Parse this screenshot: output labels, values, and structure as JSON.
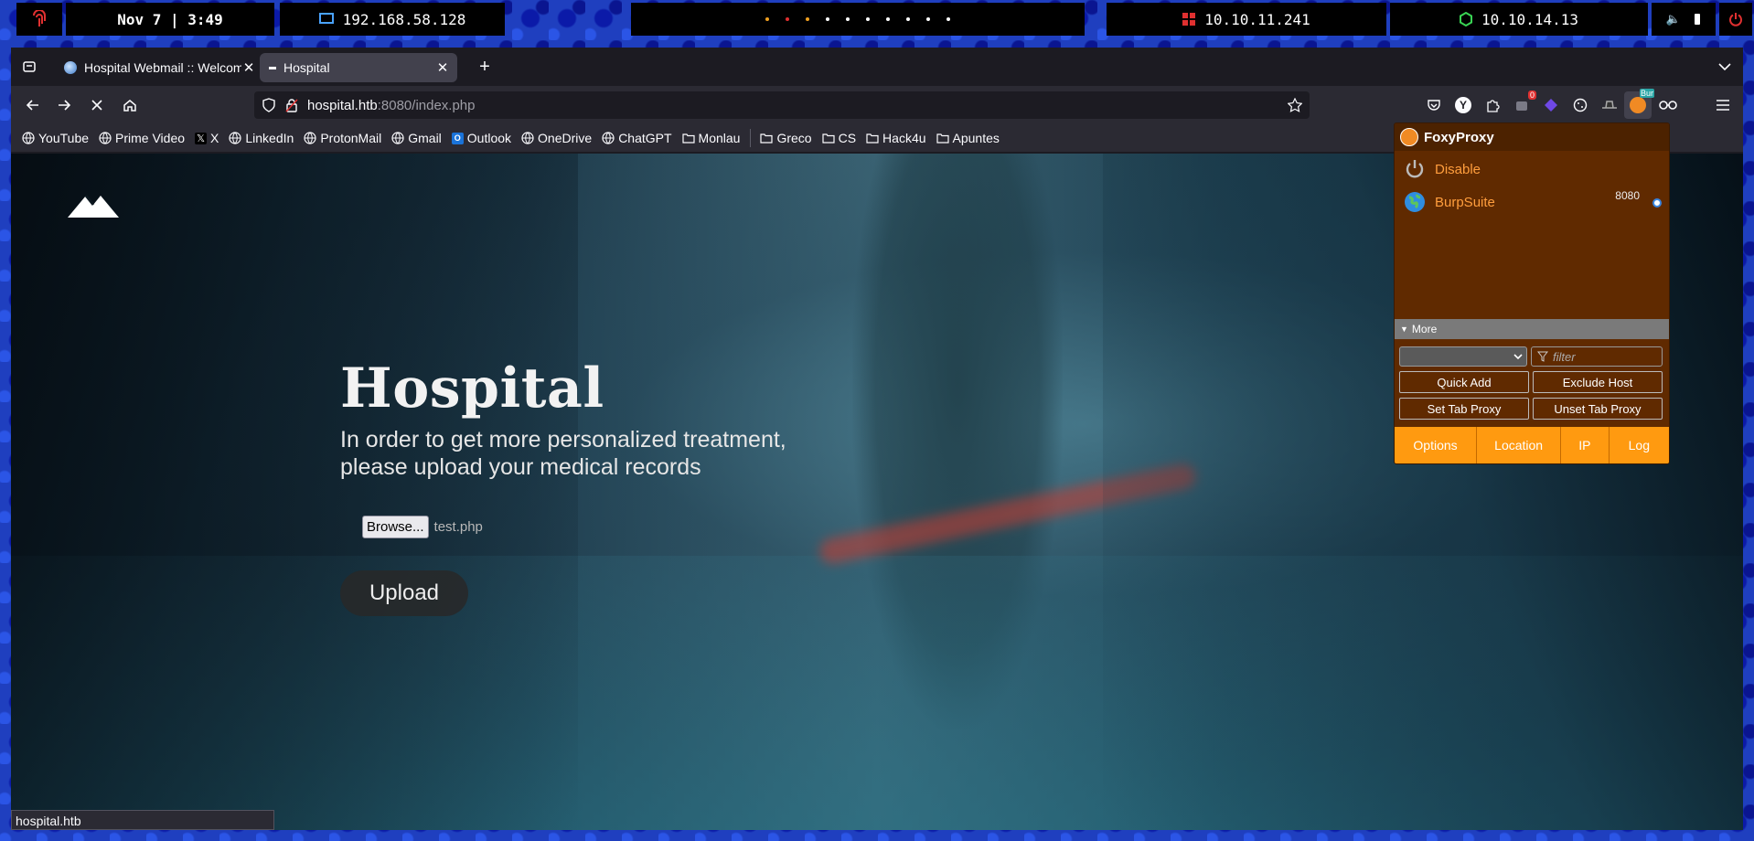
{
  "system_panel": {
    "datetime": "Nov 7 | 3:49",
    "local_ip": "192.168.58.128",
    "target_ip": "10.10.11.241",
    "vpn_ip": "10.10.14.13"
  },
  "tabs": [
    {
      "title": "Hospital Webmail :: Welcome",
      "active": false
    },
    {
      "title": "Hospital",
      "active": true
    }
  ],
  "urlbar": {
    "host": "hospital.htb",
    "rest": ":8080/index.php"
  },
  "bookmarks": [
    {
      "label": "YouTube",
      "icon": "globe-icon"
    },
    {
      "label": "Prime Video",
      "icon": "globe-icon"
    },
    {
      "label": "X",
      "icon": "x-logo-icon"
    },
    {
      "label": "LinkedIn",
      "icon": "globe-icon"
    },
    {
      "label": "ProtonMail",
      "icon": "globe-icon"
    },
    {
      "label": "Gmail",
      "icon": "globe-icon"
    },
    {
      "label": "Outlook",
      "icon": "outlook-icon"
    },
    {
      "label": "OneDrive",
      "icon": "globe-icon"
    },
    {
      "label": "ChatGPT",
      "icon": "globe-icon"
    },
    {
      "label": "Monlau",
      "icon": "folder-icon"
    },
    {
      "label": "Greco",
      "icon": "folder-icon"
    },
    {
      "label": "CS",
      "icon": "folder-icon"
    },
    {
      "label": "Hack4u",
      "icon": "folder-icon"
    },
    {
      "label": "Apuntes",
      "icon": "folder-icon"
    }
  ],
  "toolbar": {
    "extension_badge": "0",
    "burp_badge": "Bur"
  },
  "page": {
    "title": "Hospital",
    "subtitle": "In order to get more personalized treatment, please upload your medical records",
    "browse_label": "Browse...",
    "file_name": "test.php",
    "upload_label": "Upload"
  },
  "statusbar": {
    "text": "hospital.htb"
  },
  "foxyproxy": {
    "title": "FoxyProxy",
    "disable_label": "Disable",
    "proxy_name": "BurpSuite",
    "proxy_port": "8080",
    "more_label": "More",
    "filter_placeholder": "filter",
    "quick_add": "Quick Add",
    "exclude_host": "Exclude Host",
    "set_tab_proxy": "Set Tab Proxy",
    "unset_tab_proxy": "Unset Tab Proxy",
    "footer": [
      "Options",
      "Location",
      "IP",
      "Log"
    ]
  },
  "colors": {
    "accent_orange": "#ff9a10",
    "foxy_bg": "#602a00",
    "browser_bg": "#1c1b22"
  }
}
